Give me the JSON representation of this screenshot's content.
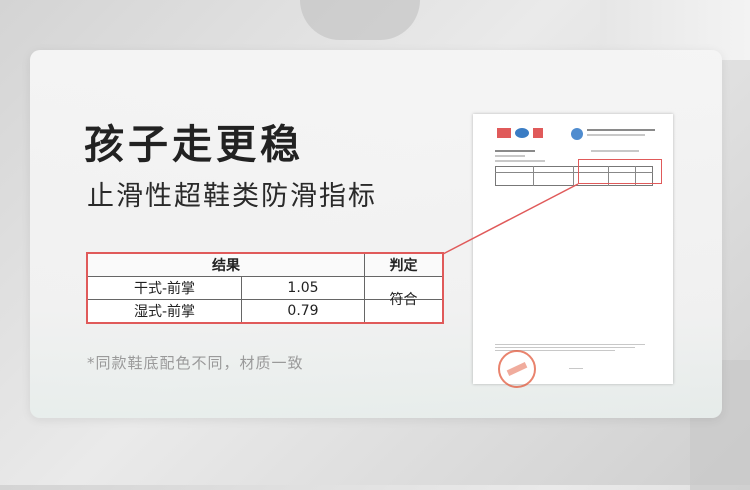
{
  "headline": "孩子走更稳",
  "subheadline": "止滑性超鞋类防滑指标",
  "result_table": {
    "headers": {
      "result": "结果",
      "judgement": "判定"
    },
    "rows": [
      {
        "label": "干式-前掌",
        "value": "1.05"
      },
      {
        "label": "湿式-前掌",
        "value": "0.79"
      }
    ],
    "judgement": "符合"
  },
  "footnote": "*同款鞋底配色不同，材质一致",
  "colors": {
    "accent": "#e05a5a",
    "title": "#222222",
    "note": "#9a9a9a"
  },
  "icons": [
    "cma-logo",
    "cnas-logo",
    "sgs-logo",
    "inspection-stamp"
  ]
}
